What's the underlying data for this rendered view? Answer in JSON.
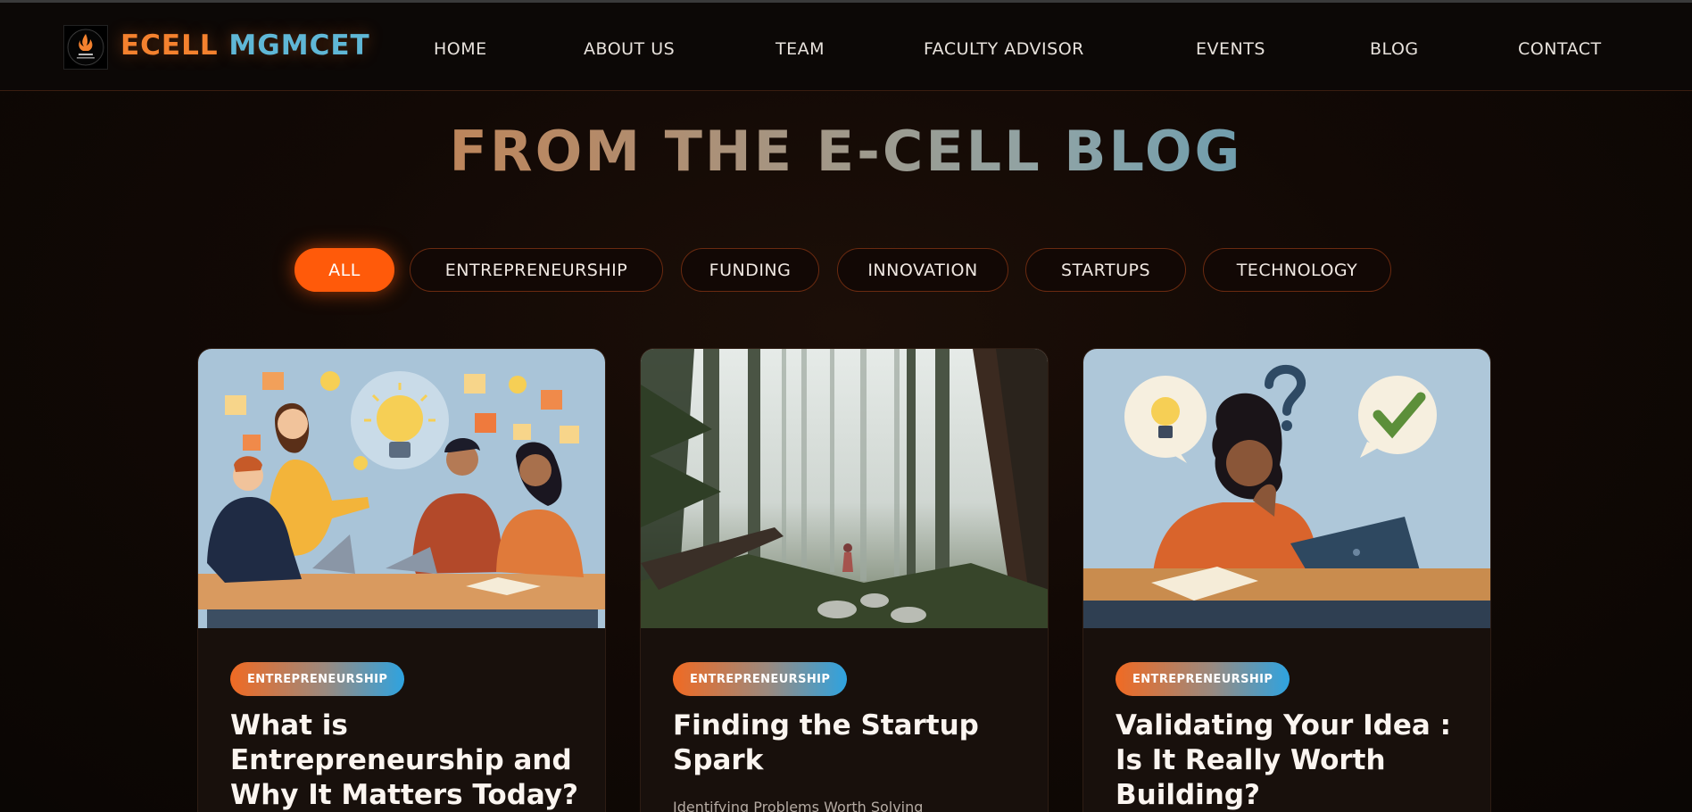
{
  "brand": {
    "part1": "ECELL",
    "part2": "MGMCET"
  },
  "nav": {
    "home": "HOME",
    "about": "ABOUT US",
    "team": "TEAM",
    "faculty": "FACULTY ADVISOR",
    "events": "EVENTS",
    "blog": "BLOG",
    "contact": "CONTACT"
  },
  "hero": {
    "title": "FROM THE E-CELL BLOG"
  },
  "filters": {
    "selected": "ALL",
    "all": "ALL",
    "entrepreneurship": "ENTREPRENEURSHIP",
    "funding": "FUNDING",
    "innovation": "INNOVATION",
    "startups": "STARTUPS",
    "technology": "TECHNOLOGY"
  },
  "cards": [
    {
      "tag": "ENTREPRENEURSHIP",
      "title": "What is Entrepreneurship and Why It Matters Today?",
      "image_icon": "team-brainstorm-illustration"
    },
    {
      "tag": "ENTREPRENEURSHIP",
      "title": "Finding the Startup Spark",
      "subtitle": "Identifying Problems Worth Solving",
      "image_icon": "misty-forest-photo"
    },
    {
      "tag": "ENTREPRENEURSHIP",
      "title": "Validating Your Idea : Is It Really Worth Building?",
      "image_icon": "thinking-woman-illustration"
    }
  ],
  "colors": {
    "accent_orange": "#ff5a0a",
    "brand_orange": "#f4812e",
    "brand_blue": "#5fb7d6",
    "background": "#120905"
  }
}
